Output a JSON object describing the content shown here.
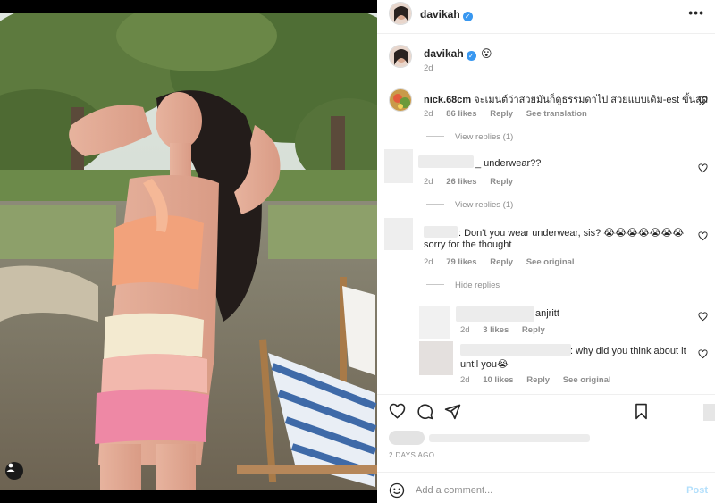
{
  "post": {
    "username": "davikah",
    "caption_emoji": "😮",
    "caption_age": "2d",
    "more_label": "•••",
    "photo_alt": "Woman in pastel cut-out dress outdoors"
  },
  "comments": [
    {
      "username": "nick.68cm",
      "text": "จะเมนต์ว่าสวยมันก็ดูธรรมดาไป สวยแบบเดิม-est ขั้นสุด",
      "age": "2d",
      "likes": "86 likes",
      "reply": "Reply",
      "extra": "See translation",
      "replies_toggle": "View replies (1)"
    },
    {
      "text": "_ underwear??",
      "age": "2d",
      "likes": "26 likes",
      "reply": "Reply",
      "replies_toggle": "View replies (1)"
    },
    {
      "text_line1": ": Don't you wear underwear, sis? 😭😭😭😭😭😭😭",
      "text_line2": "sorry for the thought",
      "age": "2d",
      "likes": "79 likes",
      "reply": "Reply",
      "extra": "See original",
      "replies_toggle": "Hide replies"
    }
  ],
  "replies": [
    {
      "text": "anjritt",
      "age": "2d",
      "likes": "3 likes",
      "reply": "Reply"
    },
    {
      "text_line1": ": why did you think about it",
      "text_line2": "until you😭",
      "age": "2d",
      "likes": "10 likes",
      "reply": "Reply",
      "extra": "See original"
    }
  ],
  "footer": {
    "date": "2 DAYS AGO",
    "add_comment_placeholder": "Add a comment...",
    "post_label": "Post"
  },
  "icons": {
    "heart": "heart-icon",
    "comment": "comment-icon",
    "share": "share-icon",
    "save": "bookmark-icon",
    "emoji": "emoji-icon",
    "verified": "verified-badge-icon"
  },
  "colors": {
    "link_blue": "#3897f0",
    "muted": "#8e8e8e",
    "post_disabled": "#b2dffc"
  }
}
